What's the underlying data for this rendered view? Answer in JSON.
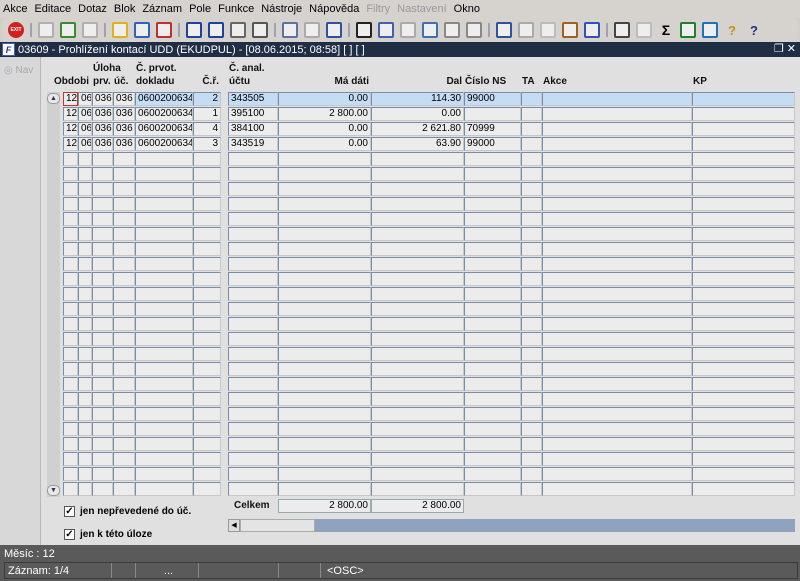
{
  "menu": [
    "Akce",
    "Editace",
    "Dotaz",
    "Blok",
    "Záznam",
    "Pole",
    "Funkce",
    "Nástroje",
    "Nápověda",
    "Filtry",
    "Nastavení",
    "Okno"
  ],
  "menu_disabled": [
    "Filtry",
    "Nastavení"
  ],
  "toolbar": {
    "exit_label": "EXIT",
    "icons": [
      "exit-icon",
      "new-record-icon",
      "save-icon",
      "delete-icon",
      "query-icon",
      "execute-query-icon",
      "cancel-query-icon",
      "sort-asc-icon",
      "sort-desc-icon",
      "wrench-icon",
      "filter-icon",
      "print-icon",
      "print-setup-icon",
      "mail-icon",
      "cut-icon",
      "copy-icon",
      "paste-icon",
      "search-icon",
      "indent-icon",
      "columns-icon",
      "calendar-icon",
      "document-icon",
      "globe-icon",
      "wheel-icon",
      "triangle-icon",
      "chart-icon",
      "clock-icon",
      "sum-icon",
      "excel-icon",
      "ie-icon",
      "help-users-icon",
      "help-icon"
    ]
  },
  "window": {
    "title": "03609 - Prohlížení kontací UDD (EKUDPUL) - [08.06.2015; 08:58]  [ ]  [ ]"
  },
  "nav_label": "Nav",
  "columns": [
    {
      "label": [
        "",
        "Obdobi"
      ]
    },
    {
      "label": [
        "Úloha",
        "prv."
      ]
    },
    {
      "label": [
        "",
        "úč."
      ]
    },
    {
      "label": [
        "Č. prvot.",
        "dokladu"
      ]
    },
    {
      "label": [
        "",
        "Č.ř."
      ]
    },
    {
      "label": [
        "Č. anal.",
        "účtu"
      ]
    },
    {
      "label": [
        "",
        "Má dáti"
      ]
    },
    {
      "label": [
        "",
        "Dal"
      ]
    },
    {
      "label": [
        "",
        "Číslo NS"
      ]
    },
    {
      "label": [
        "",
        "TA"
      ]
    },
    {
      "label": [
        "",
        "Akce"
      ]
    },
    {
      "label": [
        "",
        "KP"
      ]
    }
  ],
  "rows": [
    [
      "12",
      "06",
      "036",
      "036",
      "0600200634",
      "2",
      "343505",
      "0.00",
      "114.30",
      "99000",
      "",
      "",
      ""
    ],
    [
      "12",
      "06",
      "036",
      "036",
      "0600200634",
      "1",
      "395100",
      "2 800.00",
      "0.00",
      "",
      "",
      "",
      ""
    ],
    [
      "12",
      "06",
      "036",
      "036",
      "0600200634",
      "4",
      "384100",
      "0.00",
      "2 621.80",
      "70999",
      "",
      "",
      ""
    ],
    [
      "12",
      "06",
      "036",
      "036",
      "0600200634",
      "3",
      "343519",
      "0.00",
      "63.90",
      "99000",
      "",
      "",
      ""
    ]
  ],
  "totals": {
    "label": "Celkem",
    "ma_dati": "2 800.00",
    "dal": "2 800.00"
  },
  "filters": [
    {
      "label": "jen nepřevedené do úč.",
      "checked": true
    },
    {
      "label": "jen k této úloze",
      "checked": true
    }
  ],
  "status": {
    "line1": "Měsíc : 12",
    "record": "Záznam: 1/4",
    "ellipsis": "...",
    "mode": "<OSC>"
  },
  "colors": {
    "selected_row": "#c4ddf4",
    "title_bar": "#1f2d45",
    "status_bar": "#5a5a5a"
  }
}
